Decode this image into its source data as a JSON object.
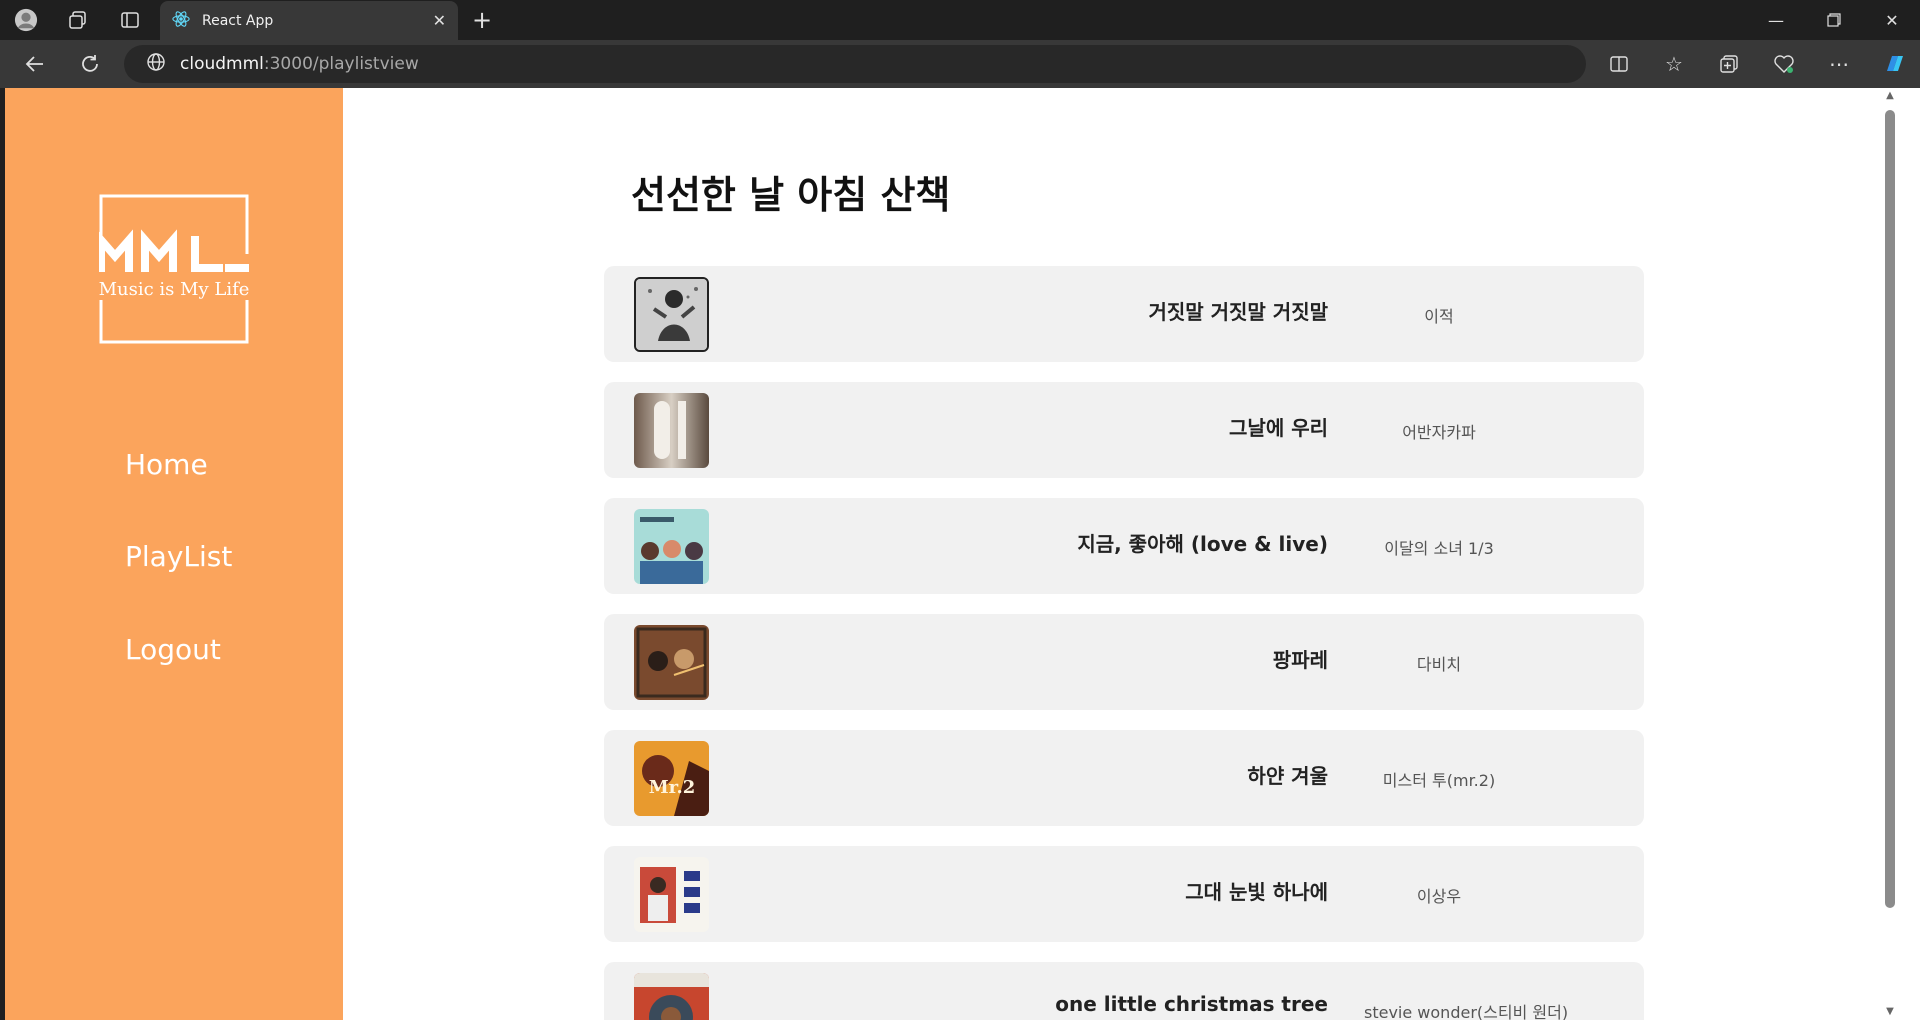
{
  "browser": {
    "tab_title": "React App",
    "url_host": "cloudmml",
    "url_rest": ":3000/playlistview"
  },
  "sidebar": {
    "logo_text": "MML",
    "logo_tagline": "Music is My Life",
    "menu": [
      {
        "label": "Home"
      },
      {
        "label": "PlayList"
      },
      {
        "label": "Logout"
      }
    ]
  },
  "playlist": {
    "title": "선선한 날 아침 산책",
    "songs": [
      {
        "title": "거짓말 거짓말 거짓말",
        "artist": "이적"
      },
      {
        "title": "그날에 우리",
        "artist": "어반자카파"
      },
      {
        "title": "지금, 좋아해 (love & live)",
        "artist": "이달의 소녀 1/3"
      },
      {
        "title": "팡파레",
        "artist": "다비치"
      },
      {
        "title": "하얀 겨울",
        "artist": "미스터 투(mr.2)"
      },
      {
        "title": "그대 눈빛 하나에",
        "artist": "이상우"
      },
      {
        "title": "one little christmas tree",
        "artist": "stevie wonder(스티비 원더)"
      }
    ]
  },
  "colors": {
    "sidebar": "#fba45c",
    "row_bg": "#f1f1f1"
  }
}
